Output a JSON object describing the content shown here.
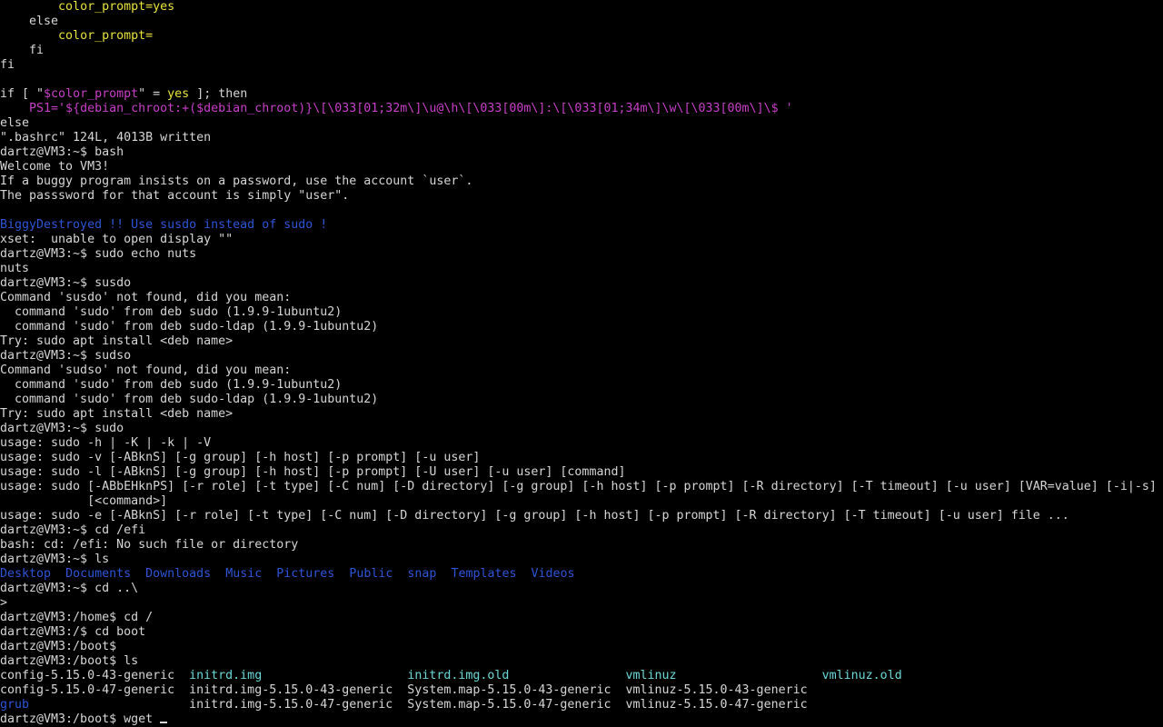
{
  "colors": {
    "background": "#000000",
    "text": "#d6d6d6",
    "yellow": "#e9e33a",
    "magenta": "#c73fc7",
    "blue": "#2e54d6",
    "cyan": "#6bd8d8"
  },
  "lines": [
    [
      {
        "c": "w",
        "t": "        "
      },
      {
        "c": "y",
        "t": "color_prompt=yes"
      }
    ],
    [
      {
        "c": "w",
        "t": "    else"
      }
    ],
    [
      {
        "c": "w",
        "t": "        "
      },
      {
        "c": "y",
        "t": "color_prompt="
      }
    ],
    [
      {
        "c": "w",
        "t": "    fi"
      }
    ],
    [
      {
        "c": "w",
        "t": "fi"
      }
    ],
    [
      {
        "c": "w",
        "t": ""
      }
    ],
    [
      {
        "c": "w",
        "t": "if [ \""
      },
      {
        "c": "m",
        "t": "$color_prompt"
      },
      {
        "c": "w",
        "t": "\" = "
      },
      {
        "c": "y",
        "t": "yes"
      },
      {
        "c": "w",
        "t": " ]; then"
      }
    ],
    [
      {
        "c": "w",
        "t": "    "
      },
      {
        "c": "m",
        "t": "PS1='${debian_chroot:+($debian_chroot)}\\[\\033[01;32m\\]\\u@\\h\\[\\033[00m\\]:\\[\\033[01;34m\\]\\w\\[\\033[00m\\]\\$ '"
      }
    ],
    [
      {
        "c": "w",
        "t": "else"
      }
    ],
    [
      {
        "c": "w",
        "t": "\".bashrc\" 124L, 4013B written"
      }
    ],
    [
      {
        "c": "w",
        "t": "dartz@VM3:~$ bash"
      }
    ],
    [
      {
        "c": "w",
        "t": "Welcome to VM3!"
      }
    ],
    [
      {
        "c": "w",
        "t": "If a buggy program insists on a password, use the account `user`."
      }
    ],
    [
      {
        "c": "w",
        "t": "The passsword for that account is simply \"user\"."
      }
    ],
    [
      {
        "c": "w",
        "t": ""
      }
    ],
    [
      {
        "c": "b",
        "t": "BiggyDestroyed !! Use susdo instead of sudo !"
      }
    ],
    [
      {
        "c": "w",
        "t": "xset:  unable to open display \"\""
      }
    ],
    [
      {
        "c": "w",
        "t": "dartz@VM3:~$ sudo echo nuts"
      }
    ],
    [
      {
        "c": "w",
        "t": "nuts"
      }
    ],
    [
      {
        "c": "w",
        "t": "dartz@VM3:~$ susdo"
      }
    ],
    [
      {
        "c": "w",
        "t": "Command 'susdo' not found, did you mean:"
      }
    ],
    [
      {
        "c": "w",
        "t": "  command 'sudo' from deb sudo (1.9.9-1ubuntu2)"
      }
    ],
    [
      {
        "c": "w",
        "t": "  command 'sudo' from deb sudo-ldap (1.9.9-1ubuntu2)"
      }
    ],
    [
      {
        "c": "w",
        "t": "Try: sudo apt install <deb name>"
      }
    ],
    [
      {
        "c": "w",
        "t": "dartz@VM3:~$ sudso"
      }
    ],
    [
      {
        "c": "w",
        "t": "Command 'sudso' not found, did you mean:"
      }
    ],
    [
      {
        "c": "w",
        "t": "  command 'sudo' from deb sudo (1.9.9-1ubuntu2)"
      }
    ],
    [
      {
        "c": "w",
        "t": "  command 'sudo' from deb sudo-ldap (1.9.9-1ubuntu2)"
      }
    ],
    [
      {
        "c": "w",
        "t": "Try: sudo apt install <deb name>"
      }
    ],
    [
      {
        "c": "w",
        "t": "dartz@VM3:~$ sudo"
      }
    ],
    [
      {
        "c": "w",
        "t": "usage: sudo -h | -K | -k | -V"
      }
    ],
    [
      {
        "c": "w",
        "t": "usage: sudo -v [-ABknS] [-g group] [-h host] [-p prompt] [-u user]"
      }
    ],
    [
      {
        "c": "w",
        "t": "usage: sudo -l [-ABknS] [-g group] [-h host] [-p prompt] [-U user] [-u user] [command]"
      }
    ],
    [
      {
        "c": "w",
        "t": "usage: sudo [-ABbEHknPS] [-r role] [-t type] [-C num] [-D directory] [-g group] [-h host] [-p prompt] [-R directory] [-T timeout] [-u user] [VAR=value] [-i|-s]"
      }
    ],
    [
      {
        "c": "w",
        "t": "            [<command>]"
      }
    ],
    [
      {
        "c": "w",
        "t": "usage: sudo -e [-ABknS] [-r role] [-t type] [-C num] [-D directory] [-g group] [-h host] [-p prompt] [-R directory] [-T timeout] [-u user] file ..."
      }
    ],
    [
      {
        "c": "w",
        "t": "dartz@VM3:~$ cd /efi"
      }
    ],
    [
      {
        "c": "w",
        "t": "bash: cd: /efi: No such file or directory"
      }
    ],
    [
      {
        "c": "w",
        "t": "dartz@VM3:~$ ls"
      }
    ],
    [
      {
        "c": "b",
        "t": "Desktop"
      },
      {
        "c": "w",
        "t": "  "
      },
      {
        "c": "b",
        "t": "Documents"
      },
      {
        "c": "w",
        "t": "  "
      },
      {
        "c": "b",
        "t": "Downloads"
      },
      {
        "c": "w",
        "t": "  "
      },
      {
        "c": "b",
        "t": "Music"
      },
      {
        "c": "w",
        "t": "  "
      },
      {
        "c": "b",
        "t": "Pictures"
      },
      {
        "c": "w",
        "t": "  "
      },
      {
        "c": "b",
        "t": "Public"
      },
      {
        "c": "w",
        "t": "  "
      },
      {
        "c": "b",
        "t": "snap"
      },
      {
        "c": "w",
        "t": "  "
      },
      {
        "c": "b",
        "t": "Templates"
      },
      {
        "c": "w",
        "t": "  "
      },
      {
        "c": "b",
        "t": "Videos"
      }
    ],
    [
      {
        "c": "w",
        "t": "dartz@VM3:~$ cd ..\\"
      }
    ],
    [
      {
        "c": "w",
        "t": ">"
      }
    ],
    [
      {
        "c": "w",
        "t": "dartz@VM3:/home$ cd /"
      }
    ],
    [
      {
        "c": "w",
        "t": "dartz@VM3:/$ cd boot"
      }
    ],
    [
      {
        "c": "w",
        "t": "dartz@VM3:/boot$"
      }
    ],
    [
      {
        "c": "w",
        "t": "dartz@VM3:/boot$ ls"
      }
    ],
    [
      {
        "c": "w",
        "t": "config-5.15.0-43-generic  "
      },
      {
        "c": "c",
        "t": "initrd.img"
      },
      {
        "c": "w",
        "t": "                    "
      },
      {
        "c": "c",
        "t": "initrd.img.old"
      },
      {
        "c": "w",
        "t": "                "
      },
      {
        "c": "c",
        "t": "vmlinuz"
      },
      {
        "c": "w",
        "t": "                    "
      },
      {
        "c": "c",
        "t": "vmlinuz.old"
      }
    ],
    [
      {
        "c": "w",
        "t": "config-5.15.0-47-generic  initrd.img-5.15.0-43-generic  System.map-5.15.0-43-generic  vmlinuz-5.15.0-43-generic"
      }
    ],
    [
      {
        "c": "b",
        "t": "grub"
      },
      {
        "c": "w",
        "t": "                      initrd.img-5.15.0-47-generic  System.map-5.15.0-47-generic  vmlinuz-5.15.0-47-generic"
      }
    ],
    [
      {
        "c": "w",
        "t": "dartz@VM3:/boot$ wget "
      }
    ]
  ]
}
